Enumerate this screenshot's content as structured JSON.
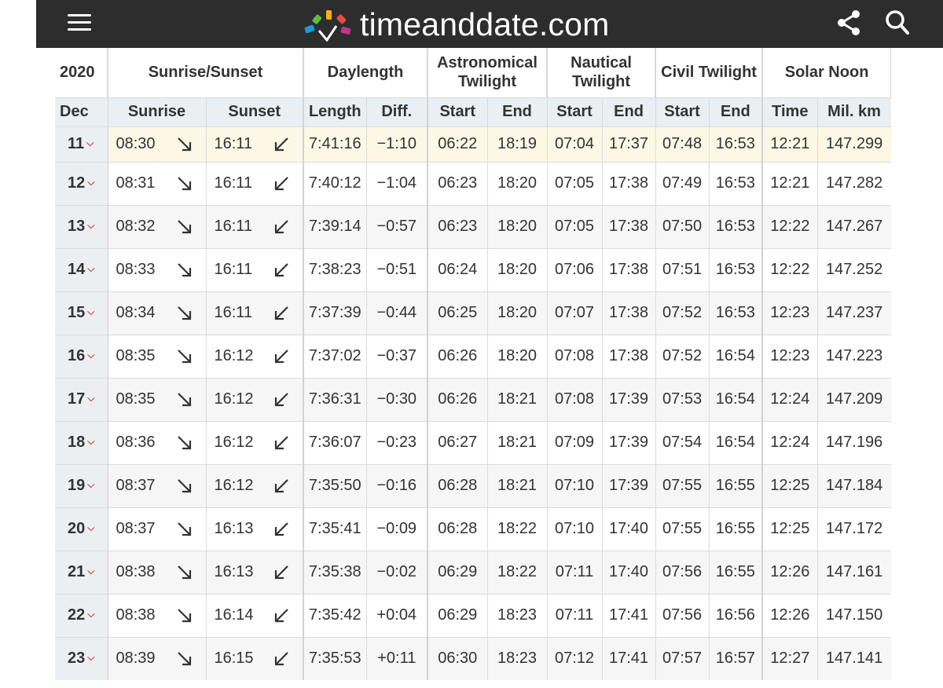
{
  "site": {
    "name": "timeanddate.com"
  },
  "icons": {
    "menu": "hamburger-menu-icon",
    "share": "share-icon",
    "search": "search-icon",
    "sunrise_arrow": "arrow-down-right-icon",
    "sunset_arrow": "arrow-down-left-icon",
    "day_dropdown": "chevron-down-icon"
  },
  "colors": {
    "topbar": "#2d2d2d",
    "today_row": "#fdf8e6",
    "header_row2": "#eaeff3",
    "chevron": "#d63b3b"
  },
  "table": {
    "header_groups": {
      "year": "2020",
      "sunrise_sunset": "Sunrise/Sunset",
      "daylength": "Daylength",
      "astronomical": "Astronomical Twilight",
      "nautical": "Nautical Twilight",
      "civil": "Civil Twilight",
      "solar_noon": "Solar Noon"
    },
    "subheaders": {
      "month": "Dec",
      "sunrise": "Sunrise",
      "sunset": "Sunset",
      "length": "Length",
      "diff": "Diff.",
      "astro_start": "Start",
      "astro_end": "End",
      "naut_start": "Start",
      "naut_end": "End",
      "civil_start": "Start",
      "civil_end": "End",
      "noon_time": "Time",
      "mil_km": "Mil. km"
    },
    "rows": [
      {
        "day": "11",
        "sunrise": "08:30",
        "sunset": "16:11",
        "length": "7:41:16",
        "diff": "−1:10",
        "astro_start": "06:22",
        "astro_end": "18:19",
        "naut_start": "07:04",
        "naut_end": "17:37",
        "civil_start": "07:48",
        "civil_end": "16:53",
        "noon": "12:21",
        "mil_km": "147.299"
      },
      {
        "day": "12",
        "sunrise": "08:31",
        "sunset": "16:11",
        "length": "7:40:12",
        "diff": "−1:04",
        "astro_start": "06:23",
        "astro_end": "18:20",
        "naut_start": "07:05",
        "naut_end": "17:38",
        "civil_start": "07:49",
        "civil_end": "16:53",
        "noon": "12:21",
        "mil_km": "147.282"
      },
      {
        "day": "13",
        "sunrise": "08:32",
        "sunset": "16:11",
        "length": "7:39:14",
        "diff": "−0:57",
        "astro_start": "06:23",
        "astro_end": "18:20",
        "naut_start": "07:05",
        "naut_end": "17:38",
        "civil_start": "07:50",
        "civil_end": "16:53",
        "noon": "12:22",
        "mil_km": "147.267"
      },
      {
        "day": "14",
        "sunrise": "08:33",
        "sunset": "16:11",
        "length": "7:38:23",
        "diff": "−0:51",
        "astro_start": "06:24",
        "astro_end": "18:20",
        "naut_start": "07:06",
        "naut_end": "17:38",
        "civil_start": "07:51",
        "civil_end": "16:53",
        "noon": "12:22",
        "mil_km": "147.252"
      },
      {
        "day": "15",
        "sunrise": "08:34",
        "sunset": "16:11",
        "length": "7:37:39",
        "diff": "−0:44",
        "astro_start": "06:25",
        "astro_end": "18:20",
        "naut_start": "07:07",
        "naut_end": "17:38",
        "civil_start": "07:52",
        "civil_end": "16:53",
        "noon": "12:23",
        "mil_km": "147.237"
      },
      {
        "day": "16",
        "sunrise": "08:35",
        "sunset": "16:12",
        "length": "7:37:02",
        "diff": "−0:37",
        "astro_start": "06:26",
        "astro_end": "18:20",
        "naut_start": "07:08",
        "naut_end": "17:38",
        "civil_start": "07:52",
        "civil_end": "16:54",
        "noon": "12:23",
        "mil_km": "147.223"
      },
      {
        "day": "17",
        "sunrise": "08:35",
        "sunset": "16:12",
        "length": "7:36:31",
        "diff": "−0:30",
        "astro_start": "06:26",
        "astro_end": "18:21",
        "naut_start": "07:08",
        "naut_end": "17:39",
        "civil_start": "07:53",
        "civil_end": "16:54",
        "noon": "12:24",
        "mil_km": "147.209"
      },
      {
        "day": "18",
        "sunrise": "08:36",
        "sunset": "16:12",
        "length": "7:36:07",
        "diff": "−0:23",
        "astro_start": "06:27",
        "astro_end": "18:21",
        "naut_start": "07:09",
        "naut_end": "17:39",
        "civil_start": "07:54",
        "civil_end": "16:54",
        "noon": "12:24",
        "mil_km": "147.196"
      },
      {
        "day": "19",
        "sunrise": "08:37",
        "sunset": "16:12",
        "length": "7:35:50",
        "diff": "−0:16",
        "astro_start": "06:28",
        "astro_end": "18:21",
        "naut_start": "07:10",
        "naut_end": "17:39",
        "civil_start": "07:55",
        "civil_end": "16:55",
        "noon": "12:25",
        "mil_km": "147.184"
      },
      {
        "day": "20",
        "sunrise": "08:37",
        "sunset": "16:13",
        "length": "7:35:41",
        "diff": "−0:09",
        "astro_start": "06:28",
        "astro_end": "18:22",
        "naut_start": "07:10",
        "naut_end": "17:40",
        "civil_start": "07:55",
        "civil_end": "16:55",
        "noon": "12:25",
        "mil_km": "147.172"
      },
      {
        "day": "21",
        "sunrise": "08:38",
        "sunset": "16:13",
        "length": "7:35:38",
        "diff": "−0:02",
        "astro_start": "06:29",
        "astro_end": "18:22",
        "naut_start": "07:11",
        "naut_end": "17:40",
        "civil_start": "07:56",
        "civil_end": "16:55",
        "noon": "12:26",
        "mil_km": "147.161"
      },
      {
        "day": "22",
        "sunrise": "08:38",
        "sunset": "16:14",
        "length": "7:35:42",
        "diff": "+0:04",
        "astro_start": "06:29",
        "astro_end": "18:23",
        "naut_start": "07:11",
        "naut_end": "17:41",
        "civil_start": "07:56",
        "civil_end": "16:56",
        "noon": "12:26",
        "mil_km": "147.150"
      },
      {
        "day": "23",
        "sunrise": "08:39",
        "sunset": "16:15",
        "length": "7:35:53",
        "diff": "+0:11",
        "astro_start": "06:30",
        "astro_end": "18:23",
        "naut_start": "07:12",
        "naut_end": "17:41",
        "civil_start": "07:57",
        "civil_end": "16:57",
        "noon": "12:27",
        "mil_km": "147.141"
      }
    ]
  }
}
